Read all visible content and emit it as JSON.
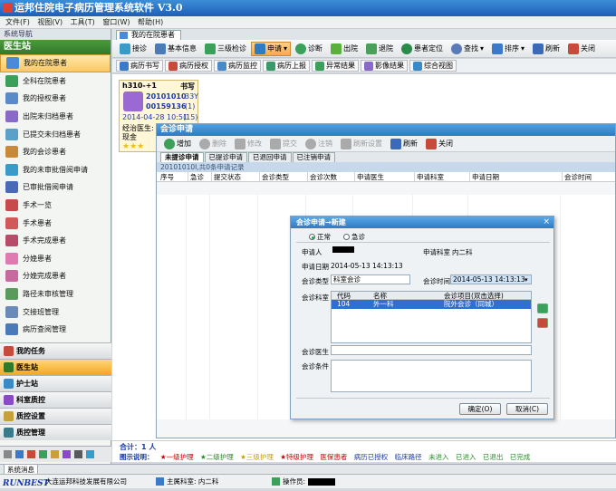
{
  "app": {
    "title": "运邦住院电子病历管理系统软件 V3.0"
  },
  "menu": [
    "文件(F)",
    "视图(V)",
    "工具(T)",
    "窗口(W)",
    "帮助(H)"
  ],
  "sidebar": {
    "header": "系统导航",
    "title": "医生站",
    "items": [
      "我的在院患者",
      "全科在院患者",
      "我的授权患者",
      "出院未归档患者",
      "已提交未归档患者",
      "我的会诊患者",
      "我的未审批借阅申请",
      "已审批借阅申请",
      "手术一览",
      "手术患者",
      "手术完成患者",
      "分娩患者",
      "分娩完成患者",
      "路径未审核管理",
      "交接班管理",
      "病历查阅管理"
    ],
    "groups": [
      "我的任务",
      "医生站",
      "护士站",
      "科室质控",
      "质控设置",
      "质控管理"
    ]
  },
  "doc_tab": "我的在院患者",
  "toolbar": [
    "接诊",
    "基本信息",
    "三级检诊",
    "申请",
    "诊断",
    "出院",
    "退院",
    "患者定位",
    "查找",
    "排序",
    "刷新",
    "关闭"
  ],
  "toolbar2": [
    "病历书写",
    "病历授权",
    "病历监控",
    "病历上报",
    "异常结果",
    "影像结果",
    "综合视图"
  ],
  "patient": {
    "bed": "h310-+1",
    "action": "书写",
    "id1": "20101010",
    "age": "33Y",
    "id2": "00159136",
    "count": "(1)",
    "datetime": "2014-04-28 10:51",
    "days": "(15)",
    "doctor_label": "经治医生:",
    "payment": "现金",
    "stars": "★★★"
  },
  "consult": {
    "title": "会诊申请",
    "toolbar": [
      "增加",
      "删除",
      "修改",
      "提交",
      "注销",
      "刷新设置",
      "刷新",
      "关闭"
    ],
    "tabs": [
      "未提诊申请",
      "已提诊申请",
      "已退回申请",
      "已注销申请"
    ],
    "summary": "20101010I,共0条申请记录",
    "columns": [
      "序号",
      "急诊",
      "提交状态",
      "会诊类型",
      "会诊次数",
      "申请医生",
      "申请科室",
      "申请日期",
      "会诊时间"
    ]
  },
  "dialog": {
    "title": "会诊申请→新建",
    "close": "×",
    "radio_normal": "正常",
    "radio_urgent": "急诊",
    "applicant_label": "申请人",
    "applicant_value": "",
    "dept_label": "申请科室",
    "dept_value": "内二科",
    "date_label": "申请日期",
    "date_value": "2014-05-13 14:13:13",
    "type_label": "会诊类型",
    "type_value": "科室会诊",
    "time_label": "会诊时间",
    "time_value": "2014-05-13 14:13:13",
    "consult_dept_label": "会诊科室",
    "grid_cols": [
      "代码",
      "名称",
      "会诊项目(双击选择)"
    ],
    "grid_row": [
      "104",
      "外一科",
      "院外会诊（同城）"
    ],
    "doctor_label": "会诊医生",
    "cond_label": "会诊条件",
    "ok": "确定(O)",
    "cancel": "取消(C)"
  },
  "legend": {
    "total": "合计：1 人",
    "label": "图示说明：",
    "items": [
      "★一级护理",
      "★二级护理",
      "★三级护理",
      "★特级护理",
      "医保患者",
      "病历已授权",
      "临床路径",
      "未进入",
      "已进入",
      "已退出",
      "已完成"
    ]
  },
  "status_tab": "系统消息",
  "status": {
    "logo": "RUNBEST",
    "company": "大连运邦科技发展有限公司",
    "dept": "主属科室: 内二科",
    "operator_label": "操作员:"
  },
  "colors": {
    "accent": "#2f7bc4",
    "sidebar_green": "#2f7a2a",
    "selected": "#fbc765"
  }
}
